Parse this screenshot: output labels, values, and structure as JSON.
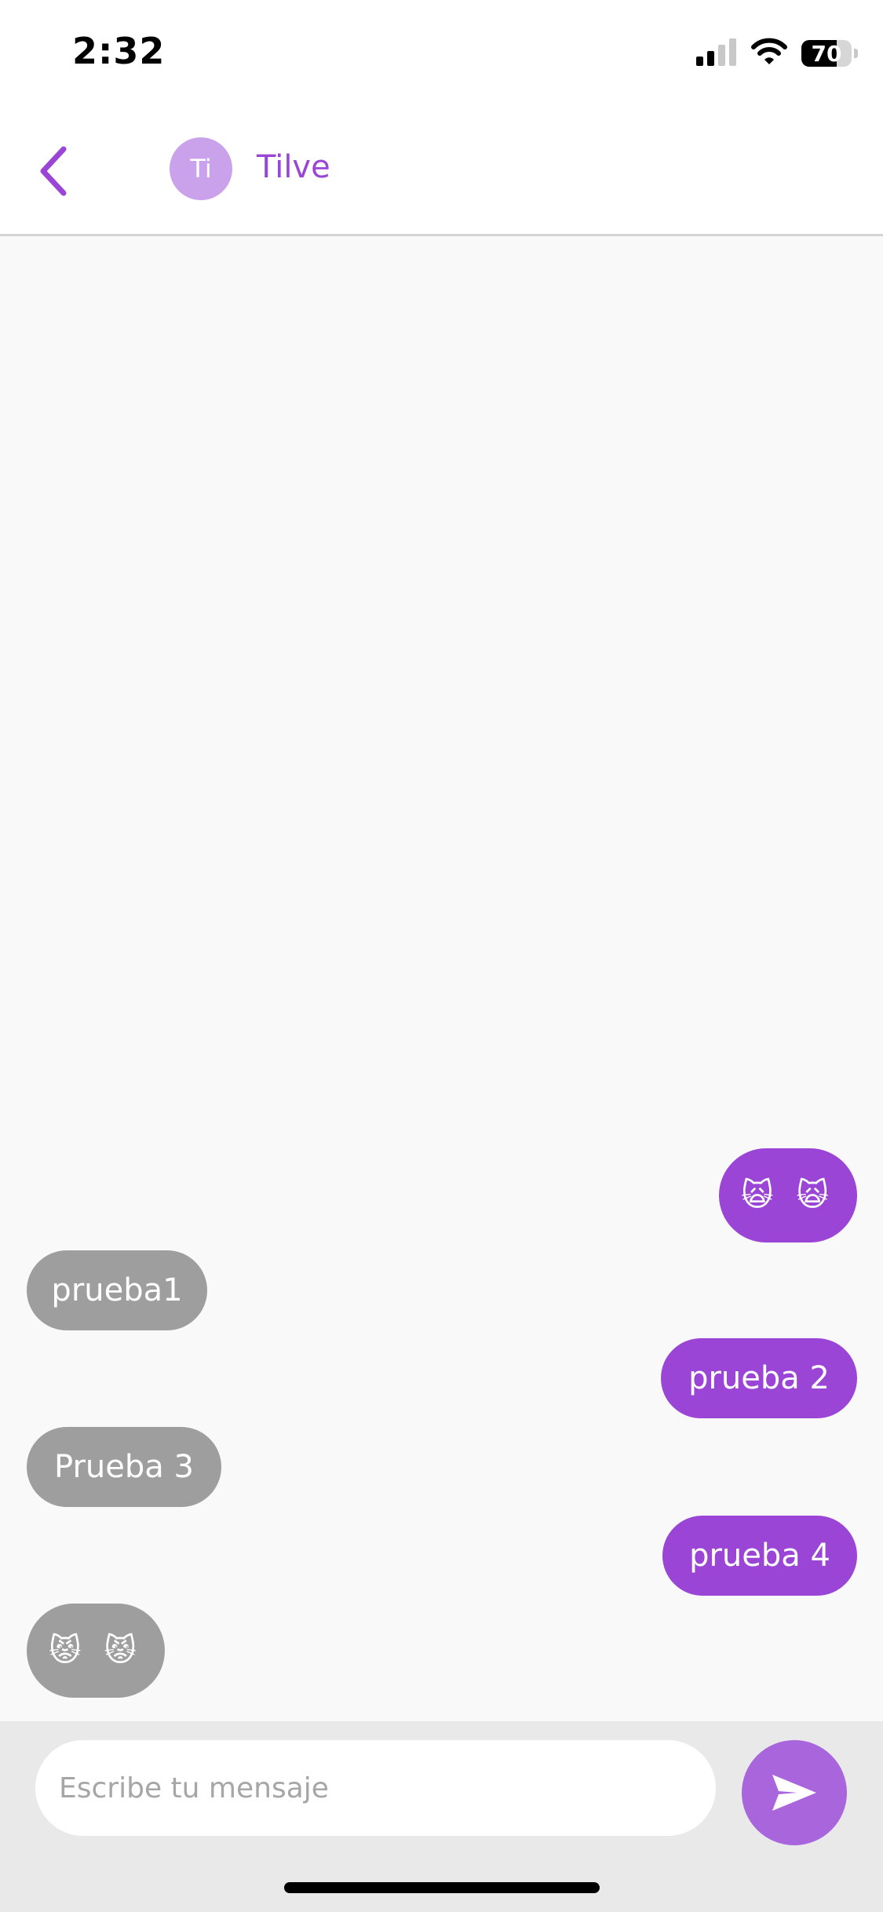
{
  "status_bar": {
    "time": "2:32",
    "battery_level": "70",
    "icons": [
      "cellular-signal-icon",
      "wifi-icon",
      "battery-icon"
    ]
  },
  "header": {
    "back_icon": "chevron-left-icon",
    "avatar_initials": "Ti",
    "contact_name": "Tilve"
  },
  "messages": [
    {
      "sender": "me",
      "text": "🙀 🙀"
    },
    {
      "sender": "other",
      "text": "prueba1"
    },
    {
      "sender": "me",
      "text": "prueba 2"
    },
    {
      "sender": "other",
      "text": "Prueba 3"
    },
    {
      "sender": "me",
      "text": "prueba 4"
    },
    {
      "sender": "other",
      "text": "😾 😾"
    }
  ],
  "composer": {
    "placeholder": "Escribe tu mensaje",
    "send_icon": "send-icon"
  },
  "colors": {
    "accent": "#9b45d6",
    "avatar_bg": "#caa2ec",
    "received_bubble": "#9e9e9e",
    "send_button": "#a966dc",
    "chat_background": "#f9f9f9",
    "composer_background": "#e9e9e9"
  }
}
